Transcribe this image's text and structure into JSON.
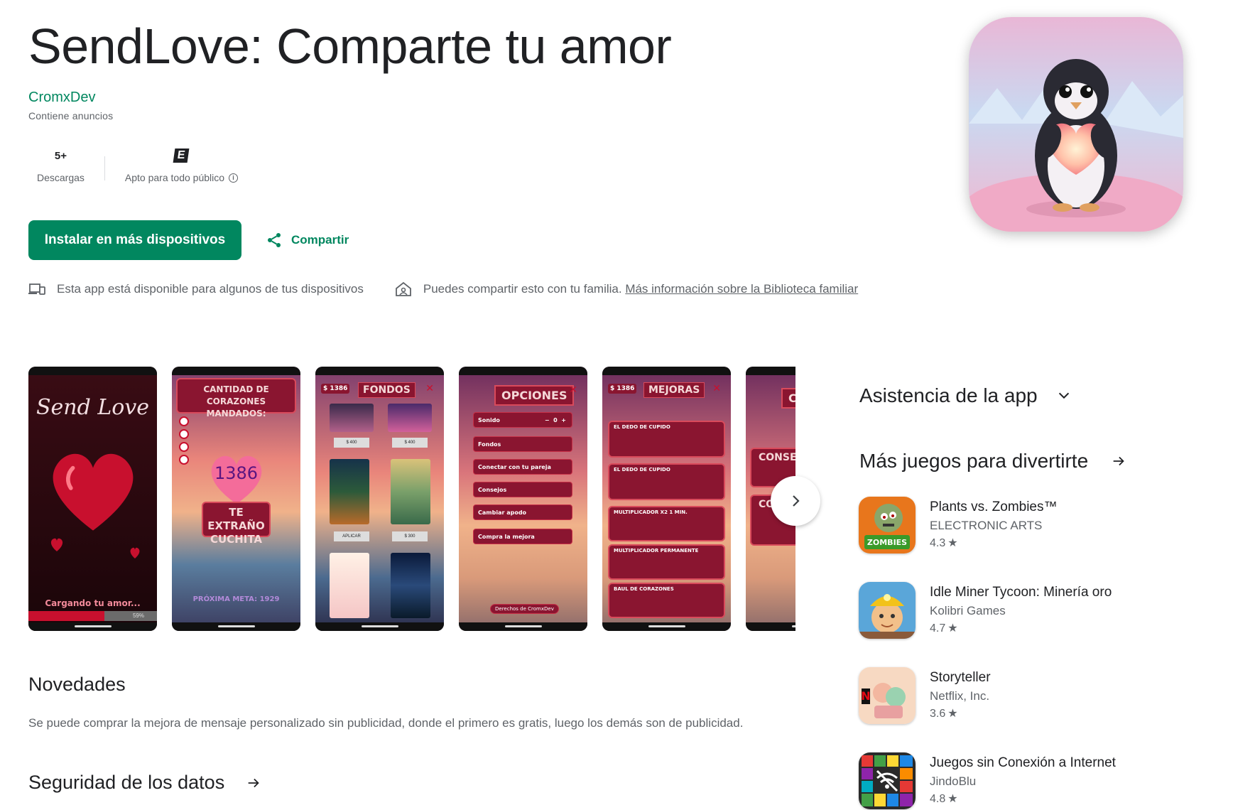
{
  "app": {
    "title": "SendLove: Comparte tu amor",
    "developer": "CromxDev",
    "ads_notice": "Contiene anuncios"
  },
  "stats": {
    "downloads_value": "5+",
    "downloads_label": "Descargas",
    "content_rating_badge": "E",
    "content_rating_label": "Apto para todo público"
  },
  "actions": {
    "install_label": "Instalar en más dispositivos",
    "share_label": "Compartir"
  },
  "notices": {
    "devices_text": "Esta app está disponible para algunos de tus dispositivos",
    "family_text": "Puedes compartir esto con tu familia.",
    "family_link": "Más información sobre la Biblioteca familiar"
  },
  "screenshots": {
    "s1": {
      "title": "Send Love",
      "loading": "Cargando tu amor...",
      "percent": "59%"
    },
    "s2": {
      "header": "CANTIDAD DE CORAZONES MANDADOS:",
      "count": "1386",
      "message": "TE EXTRAÑO CUCHITA",
      "goal": "PRÓXIMA META: 1929"
    },
    "s3": {
      "money": "$ 1386",
      "title": "FONDOS",
      "price1": "$ 400",
      "price2": "$ 400",
      "apply": "APLICAR",
      "price3": "$ 300"
    },
    "s4": {
      "title": "OPCIONES",
      "items": [
        "Sonido",
        "Fondos",
        "Conectar con tu pareja",
        "Consejos",
        "Cambiar apodo",
        "Compra la mejora"
      ],
      "sound_value": "0",
      "footer": "Derechos de CromxDev"
    },
    "s5": {
      "money": "$ 1386",
      "title": "MEJORAS",
      "upgrades": [
        "EL DEDO DE CUPIDO",
        "EL DEDO DE CUPIDO",
        "MULTIPLICADOR X2 1 MIN.",
        "MULTIPLICADOR PERMANENTE",
        "BAUL DE CORAZONES"
      ]
    },
    "s6": {
      "title": "CO",
      "card1": "CONSE",
      "card2": "CO"
    }
  },
  "sections": {
    "news_title": "Novedades",
    "news_text": "Se puede comprar la mejora de mensaje personalizado sin publicidad, donde el primero es gratis, luego los demás son de publicidad.",
    "data_safety_title": "Seguridad de los datos"
  },
  "sidebar": {
    "support_title": "Asistencia de la app",
    "more_games_title": "Más juegos para divertirte",
    "games": [
      {
        "name": "Plants vs. Zombies™",
        "developer": "ELECTRONIC ARTS",
        "rating": "4.3",
        "icon": "plants-vs-zombies-icon"
      },
      {
        "name": "Idle Miner Tycoon: Minería oro",
        "developer": "Kolibri Games",
        "rating": "4.7",
        "icon": "idle-miner-icon"
      },
      {
        "name": "Storyteller",
        "developer": "Netflix, Inc.",
        "rating": "3.6",
        "icon": "storyteller-icon"
      },
      {
        "name": "Juegos sin Conexión a Internet",
        "developer": "JindoBlu",
        "rating": "4.8",
        "icon": "offline-games-icon"
      }
    ]
  },
  "colors": {
    "brand_green": "#01875f",
    "text_primary": "#202124",
    "text_secondary": "#5f6368",
    "screenshot_red": "#8a1530"
  }
}
